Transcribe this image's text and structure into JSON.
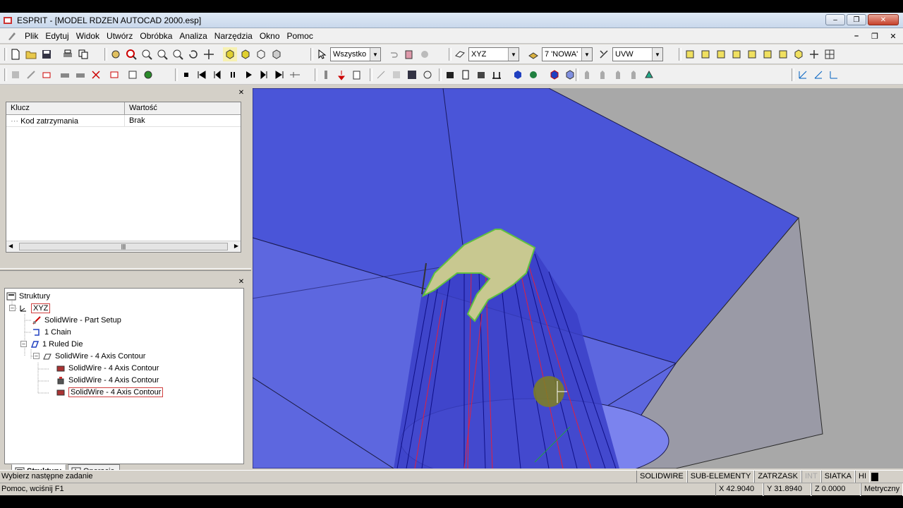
{
  "window": {
    "title": "ESPRIT - [MODEL RDZEN AUTOCAD 2000.esp]"
  },
  "menu": [
    "Plik",
    "Edytuj",
    "Widok",
    "Utwórz",
    "Obróbka",
    "Analiza",
    "Narzędzia",
    "Okno",
    "Pomoc"
  ],
  "toolbar": {
    "select_filter": "Wszystko",
    "plane": "XYZ",
    "layer": "7 'NOWA'",
    "work_plane": "UVW"
  },
  "properties": {
    "col_key": "Klucz",
    "col_value": "Wartość",
    "rows": [
      {
        "key": "Kod zatrzymania",
        "value": "Brak"
      }
    ]
  },
  "tree": {
    "root": "Struktury",
    "items": [
      {
        "label": "XYZ"
      },
      {
        "label": "SolidWire - Part Setup"
      },
      {
        "label": "1 Chain"
      },
      {
        "label": "1 Ruled Die"
      },
      {
        "label": "SolidWire - 4 Axis Contour"
      },
      {
        "label": "SolidWire - 4 Axis Contour"
      },
      {
        "label": "SolidWire - 4 Axis Contour"
      },
      {
        "label": "SolidWire - 4 Axis Contour"
      }
    ]
  },
  "tabs": [
    "Struktury",
    "Operacje"
  ],
  "status": {
    "prompt": "Wybierz następne zadanie",
    "help": "Pomoc, wciśnij F1",
    "flags": [
      "SOLIDWIRE",
      "SUB-ELEMENTY",
      "ZATRZASK",
      "INT",
      "SIATKA",
      "HI"
    ],
    "x": "X 42.9040",
    "y": "Y 31.8940",
    "z": "Z 0.0000",
    "units": "Metryczny"
  },
  "colors": {
    "viewport_plane": "#4a55d8",
    "viewport_block": "#a9a9a9",
    "part_highlight": "#c8c890"
  }
}
